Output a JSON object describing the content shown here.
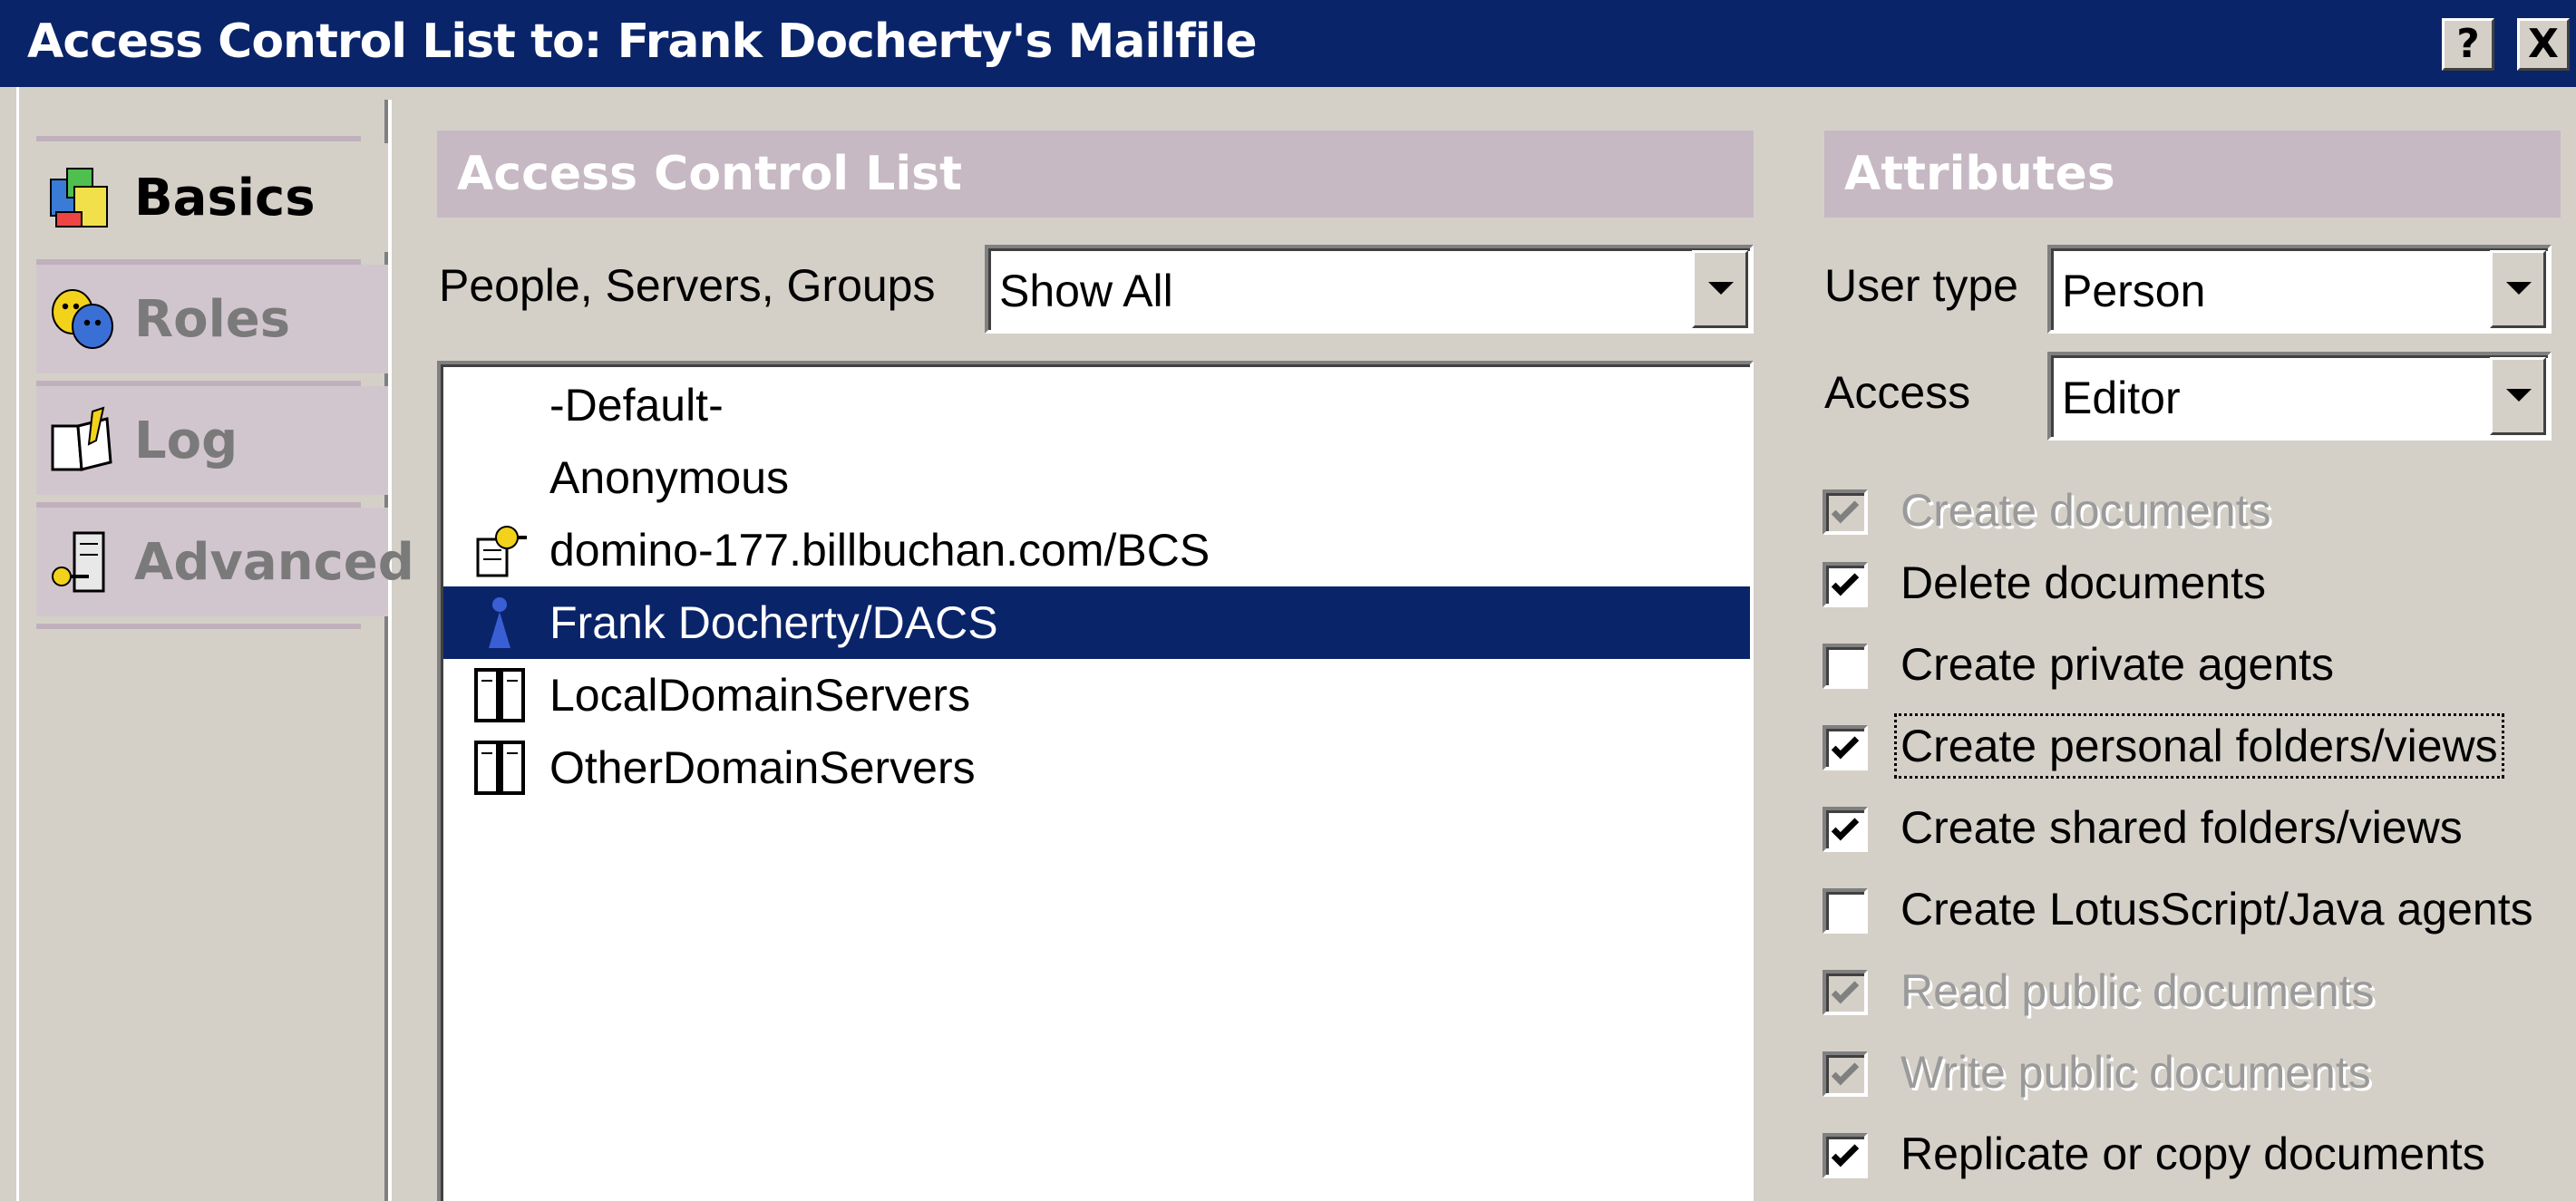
{
  "window": {
    "title": "Access Control List to: Frank Docherty's Mailfile",
    "help_button": "?",
    "close_button": "X"
  },
  "tabs": [
    {
      "label": "Basics",
      "icon": "basics-icon",
      "active": true
    },
    {
      "label": "Roles",
      "icon": "roles-icon",
      "active": false
    },
    {
      "label": "Log",
      "icon": "log-icon",
      "active": false
    },
    {
      "label": "Advanced",
      "icon": "advanced-icon",
      "active": false
    }
  ],
  "acl": {
    "header": "Access Control List",
    "filter_label": "People, Servers, Groups",
    "filter_value": "Show All",
    "entries": [
      {
        "name": "-Default-",
        "icon": ""
      },
      {
        "name": "Anonymous",
        "icon": ""
      },
      {
        "name": "domino-177.billbuchan.com/BCS",
        "icon": "server-key-icon"
      },
      {
        "name": "Frank Docherty/DACS",
        "icon": "person-icon",
        "selected": true
      },
      {
        "name": "LocalDomainServers",
        "icon": "server-group-icon"
      },
      {
        "name": "OtherDomainServers",
        "icon": "server-group-icon"
      }
    ]
  },
  "attributes": {
    "header": "Attributes",
    "user_type_label": "User type",
    "user_type_value": "Person",
    "access_label": "Access",
    "access_value": "Editor",
    "checkboxes": [
      {
        "label": "Create documents",
        "checked": true,
        "enabled": false
      },
      {
        "label": "Delete documents",
        "checked": true,
        "enabled": true
      },
      {
        "label": "Create private agents",
        "checked": false,
        "enabled": true
      },
      {
        "label": "Create personal folders/views",
        "checked": true,
        "enabled": true,
        "focused": true
      },
      {
        "label": "Create shared folders/views",
        "checked": true,
        "enabled": true
      },
      {
        "label": "Create LotusScript/Java agents",
        "checked": false,
        "enabled": true
      },
      {
        "label": "Read public documents",
        "checked": true,
        "enabled": false
      },
      {
        "label": "Write public documents",
        "checked": true,
        "enabled": false
      },
      {
        "label": "Replicate or copy documents",
        "checked": true,
        "enabled": true
      }
    ]
  }
}
